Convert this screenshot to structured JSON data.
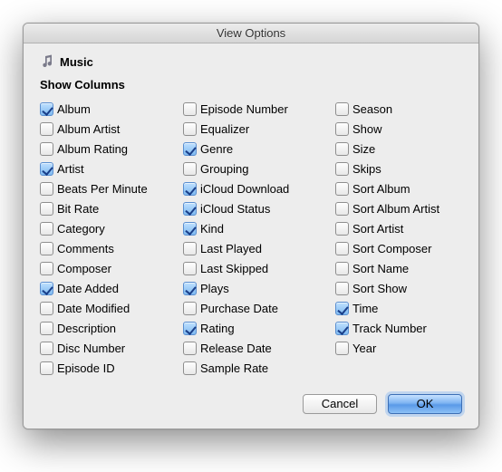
{
  "window": {
    "title": "View Options"
  },
  "header": {
    "icon": "music-icon",
    "label": "Music"
  },
  "section": {
    "heading": "Show Columns"
  },
  "columns": {
    "col1": [
      {
        "label": "Album",
        "checked": true
      },
      {
        "label": "Album Artist",
        "checked": false
      },
      {
        "label": "Album Rating",
        "checked": false
      },
      {
        "label": "Artist",
        "checked": true
      },
      {
        "label": "Beats Per Minute",
        "checked": false
      },
      {
        "label": "Bit Rate",
        "checked": false
      },
      {
        "label": "Category",
        "checked": false
      },
      {
        "label": "Comments",
        "checked": false
      },
      {
        "label": "Composer",
        "checked": false
      },
      {
        "label": "Date Added",
        "checked": true
      },
      {
        "label": "Date Modified",
        "checked": false
      },
      {
        "label": "Description",
        "checked": false
      },
      {
        "label": "Disc Number",
        "checked": false
      },
      {
        "label": "Episode ID",
        "checked": false
      }
    ],
    "col2": [
      {
        "label": "Episode Number",
        "checked": false
      },
      {
        "label": "Equalizer",
        "checked": false
      },
      {
        "label": "Genre",
        "checked": true
      },
      {
        "label": "Grouping",
        "checked": false
      },
      {
        "label": "iCloud Download",
        "checked": true
      },
      {
        "label": "iCloud Status",
        "checked": true
      },
      {
        "label": "Kind",
        "checked": true
      },
      {
        "label": "Last Played",
        "checked": false
      },
      {
        "label": "Last Skipped",
        "checked": false
      },
      {
        "label": "Plays",
        "checked": true
      },
      {
        "label": "Purchase Date",
        "checked": false
      },
      {
        "label": "Rating",
        "checked": true
      },
      {
        "label": "Release Date",
        "checked": false
      },
      {
        "label": "Sample Rate",
        "checked": false
      }
    ],
    "col3": [
      {
        "label": "Season",
        "checked": false
      },
      {
        "label": "Show",
        "checked": false
      },
      {
        "label": "Size",
        "checked": false
      },
      {
        "label": "Skips",
        "checked": false
      },
      {
        "label": "Sort Album",
        "checked": false
      },
      {
        "label": "Sort Album Artist",
        "checked": false
      },
      {
        "label": "Sort Artist",
        "checked": false
      },
      {
        "label": "Sort Composer",
        "checked": false
      },
      {
        "label": "Sort Name",
        "checked": false
      },
      {
        "label": "Sort Show",
        "checked": false
      },
      {
        "label": "Time",
        "checked": true
      },
      {
        "label": "Track Number",
        "checked": true
      },
      {
        "label": "Year",
        "checked": false
      }
    ]
  },
  "buttons": {
    "cancel": "Cancel",
    "ok": "OK"
  }
}
